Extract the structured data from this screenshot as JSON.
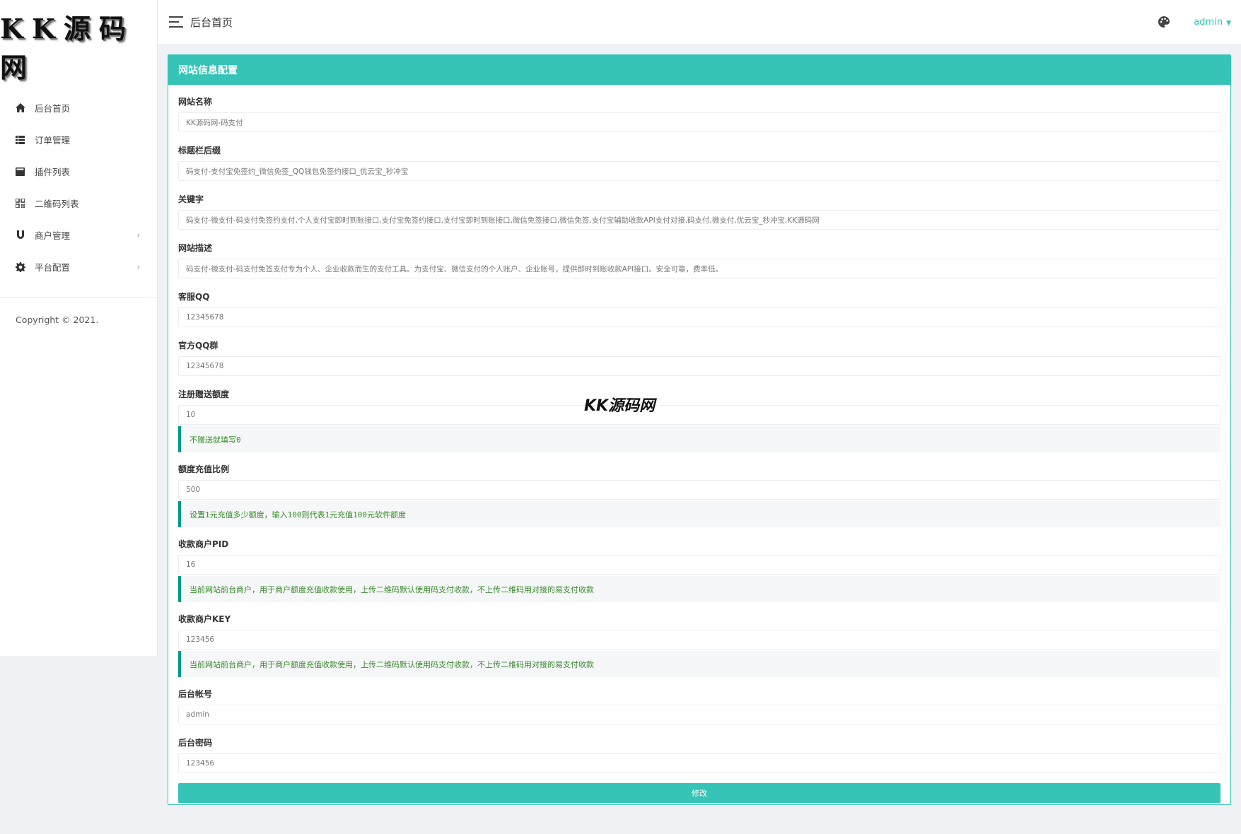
{
  "logo": {
    "text": "KK源码网"
  },
  "sidebar": {
    "items": [
      {
        "label": "后台首页",
        "icon": "home-icon"
      },
      {
        "label": "订单管理",
        "icon": "list-icon"
      },
      {
        "label": "插件列表",
        "icon": "plugin-icon"
      },
      {
        "label": "二维码列表",
        "icon": "qrcode-icon"
      },
      {
        "label": "商户管理",
        "icon": "magnet-icon",
        "has_submenu": true
      },
      {
        "label": "平台配置",
        "icon": "gear-icon",
        "has_submenu": true
      }
    ],
    "copyright": "Copyright © 2021."
  },
  "topbar": {
    "title": "后台首页",
    "user": "admin"
  },
  "panel": {
    "title": "网站信息配置",
    "fields": {
      "site_name": {
        "label": "网站名称",
        "value": "KK源码网-码支付"
      },
      "title_suffix": {
        "label": "标题栏后缀",
        "value": "码支付-支付宝免签约_微信免签_QQ钱包免签约接口_优云宝_秒冲宝"
      },
      "keywords": {
        "label": "关键字",
        "value": "码支付-微支付-码支付免签约支付,个人支付宝即时到账接口,支付宝免签约接口,支付宝即时到账接口,微信免签接口,微信免签,支付宝辅助收款API支付对接,码支付,微支付,优云宝_秒冲宝,KK源码网"
      },
      "description": {
        "label": "网站描述",
        "value": "码支付-微支付-码支付免签支付专为个人、企业收款而生的支付工具。为支付宝、微信支付的个人账户、企业账号，提供即时到账收款API接口。安全可靠，费率低。"
      },
      "service_qq": {
        "label": "客服QQ",
        "value": "12345678"
      },
      "official_qq_group": {
        "label": "官方QQ群",
        "value": "12345678"
      },
      "register_bonus": {
        "label": "注册赠送额度",
        "value": "10",
        "help": "不赠送就填写0"
      },
      "recharge_ratio": {
        "label": "额度充值比例",
        "value": "500",
        "help": "设置1元充值多少额度，输入100则代表1元充值100元软件额度"
      },
      "merchant_pid": {
        "label": "收款商户PID",
        "value": "16",
        "help": "当前网站前台商户，用于商户额度充值收款使用，上传二维码默认使用码支付收款，不上传二维码用对接的易支付收款"
      },
      "merchant_key": {
        "label": "收款商户KEY",
        "value": "123456",
        "help": "当前网站前台商户，用于商户额度充值收款使用，上传二维码默认使用码支付收款，不上传二维码用对接的易支付收款"
      },
      "admin_account": {
        "label": "后台帐号",
        "value": "admin"
      },
      "admin_password": {
        "label": "后台密码",
        "value": "123456"
      }
    },
    "submit_label": "修改"
  },
  "watermark": "KK源码网",
  "colors": {
    "accent": "#35c4b6",
    "help_border": "#009a8a",
    "help_text": "#3a8a2e",
    "sidebar_bg": "#ffffff",
    "page_bg": "#eff1f4"
  }
}
